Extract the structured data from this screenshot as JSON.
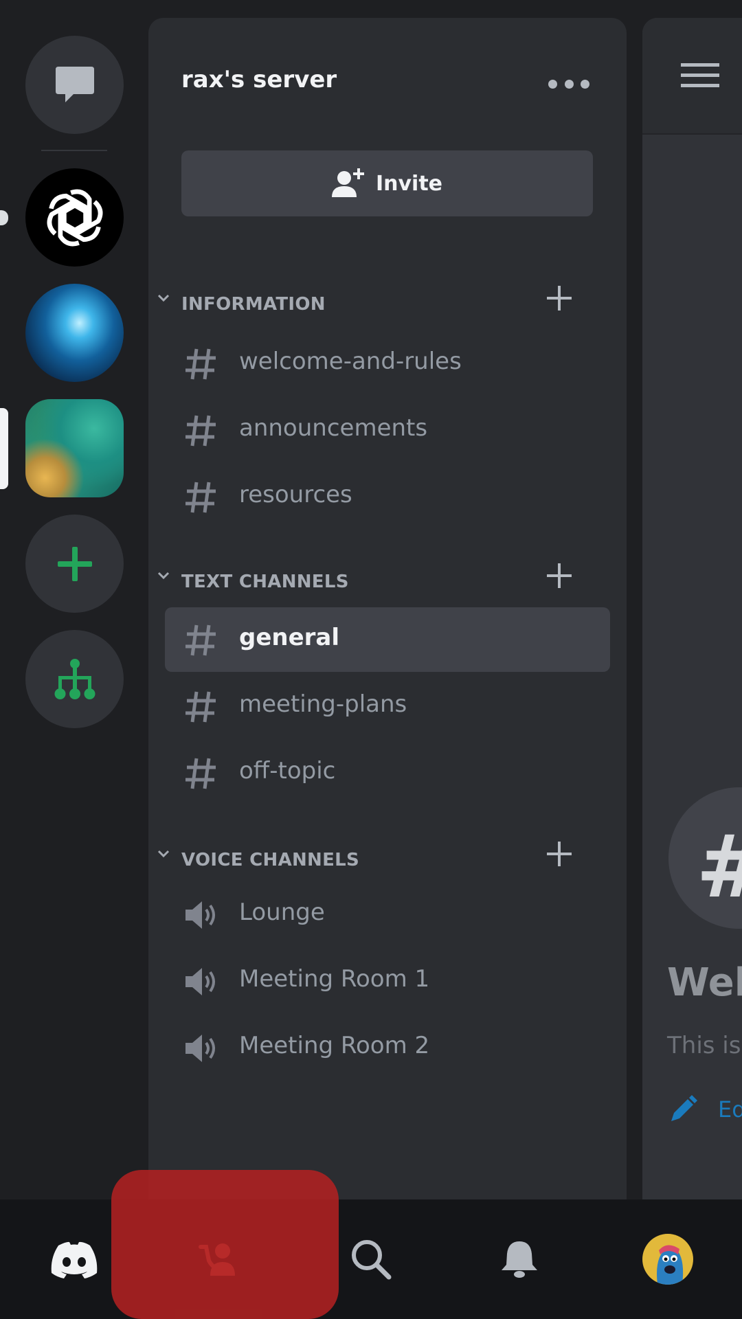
{
  "server": {
    "title": "rax's server",
    "invite_label": "Invite"
  },
  "rail": {
    "items": [
      {
        "name": "Direct Messages",
        "icon": "chat-bubble-icon"
      },
      {
        "name": "OpenAI server",
        "icon": "openai-logo"
      },
      {
        "name": "Galaxy server",
        "icon": "galaxy-image"
      },
      {
        "name": "Map server",
        "icon": "map-image"
      },
      {
        "name": "Add a Server",
        "icon": "plus-icon"
      },
      {
        "name": "Explore Discoverable Servers",
        "icon": "hierarchy-icon"
      }
    ]
  },
  "categories": [
    {
      "label": "INFORMATION",
      "channels": [
        {
          "name": "welcome-and-rules",
          "type": "text"
        },
        {
          "name": "announcements",
          "type": "text"
        },
        {
          "name": "resources",
          "type": "text"
        }
      ]
    },
    {
      "label": "TEXT CHANNELS",
      "channels": [
        {
          "name": "general",
          "type": "text",
          "selected": true
        },
        {
          "name": "meeting-plans",
          "type": "text"
        },
        {
          "name": "off-topic",
          "type": "text"
        }
      ]
    },
    {
      "label": "VOICE CHANNELS",
      "channels": [
        {
          "name": "Lounge",
          "type": "voice"
        },
        {
          "name": "Meeting Room 1",
          "type": "voice"
        },
        {
          "name": "Meeting Room 2",
          "type": "voice"
        }
      ]
    }
  ],
  "peek": {
    "hash": "#",
    "welcome": "Welc",
    "subtitle": "This is",
    "edit": "Ed"
  },
  "bottom_nav": [
    {
      "name": "Home",
      "icon": "discord-logo-icon"
    },
    {
      "name": "Friends",
      "icon": "friends-icon"
    },
    {
      "name": "Search",
      "icon": "search-icon"
    },
    {
      "name": "Notifications",
      "icon": "bell-icon"
    },
    {
      "name": "You",
      "icon": "avatar"
    }
  ],
  "colors": {
    "background": "#1e1f22",
    "panel": "#2b2d31",
    "selected": "#404249",
    "green": "#23a55a",
    "highlight": "#b02121"
  }
}
